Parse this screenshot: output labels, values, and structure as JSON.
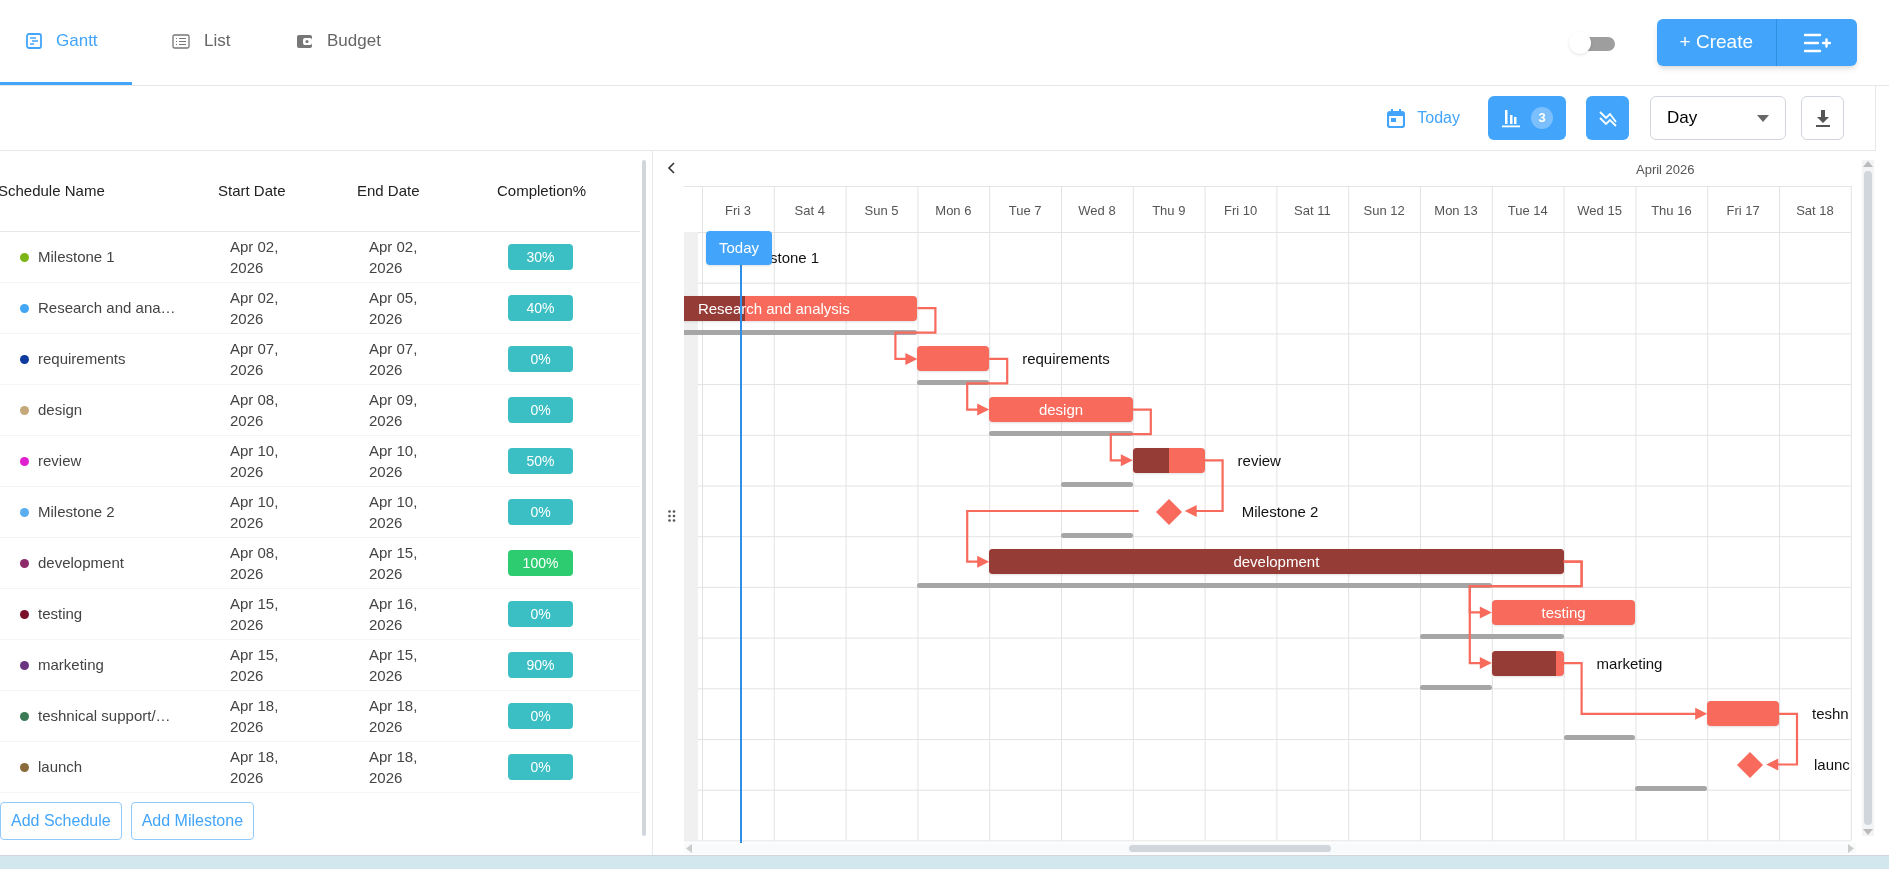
{
  "tabs": [
    {
      "label": "Gantt",
      "selected": true
    },
    {
      "label": "List",
      "selected": false
    },
    {
      "label": "Budget",
      "selected": false
    }
  ],
  "view_toggle": {
    "on": false
  },
  "create_button": {
    "label": "+ Create"
  },
  "toolbar": {
    "today": "Today",
    "baseline_count": "3",
    "scale": "Day"
  },
  "table": {
    "columns": [
      "Schedule Name",
      "Start Date",
      "End Date",
      "Completion%"
    ],
    "rows": [
      {
        "name": "Milestone 1",
        "color": "#7cb518",
        "start": "Apr 02, 2026",
        "end": "Apr 02, 2026",
        "completion": {
          "text": "30%",
          "color": "#3bbfc4"
        }
      },
      {
        "name": "Research and ana…",
        "color": "#42a5f5",
        "start": "Apr 02, 2026",
        "end": "Apr 05, 2026",
        "completion": {
          "text": "40%",
          "color": "#3bbfc4"
        }
      },
      {
        "name": "requirements",
        "color": "#0d3a9c",
        "start": "Apr 07, 2026",
        "end": "Apr 07, 2026",
        "completion": {
          "text": "0%",
          "color": "#3bbfc4"
        }
      },
      {
        "name": "design",
        "color": "#c4a87a",
        "start": "Apr 08, 2026",
        "end": "Apr 09, 2026",
        "completion": {
          "text": "0%",
          "color": "#3bbfc4"
        }
      },
      {
        "name": "review",
        "color": "#e020d0",
        "start": "Apr 10, 2026",
        "end": "Apr 10, 2026",
        "completion": {
          "text": "50%",
          "color": "#3bbfc4"
        }
      },
      {
        "name": "Milestone 2",
        "color": "#5aaef0",
        "start": "Apr 10, 2026",
        "end": "Apr 10, 2026",
        "completion": {
          "text": "0%",
          "color": "#3bbfc4"
        }
      },
      {
        "name": "development",
        "color": "#8e2a6a",
        "start": "Apr 08, 2026",
        "end": "Apr 15, 2026",
        "completion": {
          "text": "100%",
          "color": "#2ecc71"
        }
      },
      {
        "name": "testing",
        "color": "#7a0f2a",
        "start": "Apr 15, 2026",
        "end": "Apr 16, 2026",
        "completion": {
          "text": "0%",
          "color": "#3bbfc4"
        }
      },
      {
        "name": "marketing",
        "color": "#6a3480",
        "start": "Apr 15, 2026",
        "end": "Apr 15, 2026",
        "completion": {
          "text": "90%",
          "color": "#3bbfc4"
        }
      },
      {
        "name": "teshnical support/…",
        "color": "#3a7a55",
        "start": "Apr 18, 2026",
        "end": "Apr 18, 2026",
        "completion": {
          "text": "0%",
          "color": "#3bbfc4"
        }
      },
      {
        "name": "launch",
        "color": "#8a6a3a",
        "start": "Apr 18, 2026",
        "end": "Apr 18, 2026",
        "completion": {
          "text": "0%",
          "color": "#3bbfc4"
        }
      }
    ]
  },
  "buttons": [
    "Add Schedule",
    "Add Milestone"
  ],
  "timeline": {
    "month": "April 2026",
    "today_label": "Today",
    "days": [
      "Fri 3",
      "Sat 4",
      "Sun 5",
      "Mon 6",
      "Tue 7",
      "Wed 8",
      "Thu 9",
      "Fri 10",
      "Sat 11",
      "Sun 12",
      "Mon 13",
      "Tue 14",
      "Wed 15",
      "Thu 16",
      "Fri 17",
      "Sat 18"
    ],
    "rows": [
      {
        "kind": "milestone",
        "label": "stone 1"
      },
      {
        "kind": "task",
        "label": "Research and analysis",
        "level": 0.4
      },
      {
        "kind": "task",
        "label": "requirements",
        "level": 0
      },
      {
        "kind": "task",
        "label": "design",
        "level": 0
      },
      {
        "kind": "task",
        "label": "review",
        "level": 0.5
      },
      {
        "kind": "milestone",
        "label": "Milestone 2"
      },
      {
        "kind": "task",
        "label": "development",
        "level": 1
      },
      {
        "kind": "task",
        "label": "testing",
        "level": 0
      },
      {
        "kind": "task",
        "label": "marketing",
        "level": 0.9
      },
      {
        "kind": "task",
        "label": "teshn",
        "level": 0
      },
      {
        "kind": "milestone",
        "label": "launc"
      }
    ]
  }
}
